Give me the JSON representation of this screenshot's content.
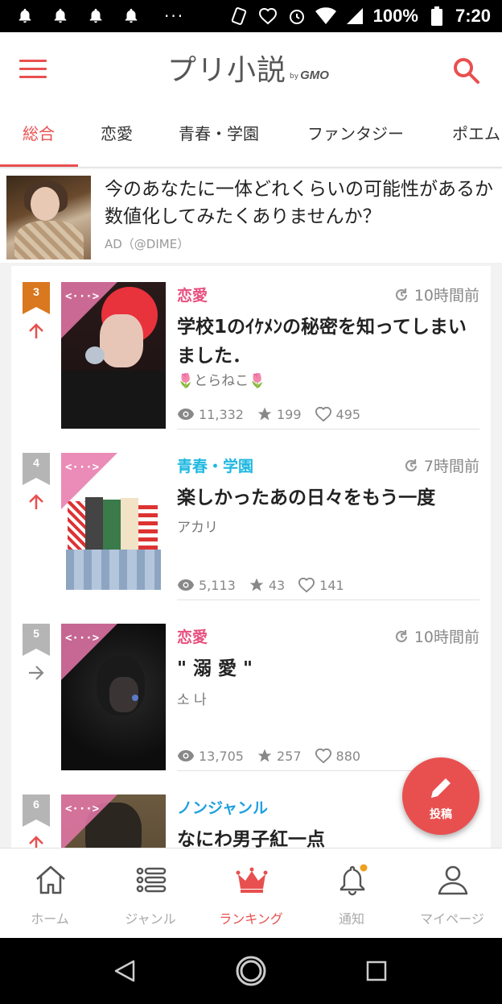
{
  "status_bar": {
    "battery": "100%",
    "time": "7:20",
    "overflow": "···"
  },
  "header": {
    "logo_main": "プリ小説",
    "logo_by": "by",
    "logo_gmo": "GMO",
    "menu_icon": "hamburger-icon",
    "search_icon": "search-icon"
  },
  "tabs": [
    {
      "label": "総合",
      "active": true
    },
    {
      "label": "恋愛",
      "active": false
    },
    {
      "label": "青春・学園",
      "active": false
    },
    {
      "label": "ファンタジー",
      "active": false
    },
    {
      "label": "ポエム",
      "active": false
    }
  ],
  "ad": {
    "title": "今のあなたに一体どれくらいの可能性があるか数値化してみたくありませんか？",
    "label": "AD（@DIME）"
  },
  "items": [
    {
      "rank": "3",
      "rank_color": "#d9781f",
      "trend": "up",
      "genre": "恋愛",
      "genre_color": "#e8507f",
      "time": "10時間前",
      "title": "学校1のｲｹﾒﾝの秘密を知ってしまいました．",
      "author": "🌷とらねこ🌷",
      "views": "11,332",
      "stars": "199",
      "likes": "495",
      "ribbon": "<···>"
    },
    {
      "rank": "4",
      "rank_color": "#b5b5b5",
      "trend": "up",
      "genre": "青春・学園",
      "genre_color": "#1fb8e0",
      "time": "7時間前",
      "title": "楽しかったあの日々をもう一度",
      "author": "アカリ",
      "views": "5,113",
      "stars": "43",
      "likes": "141",
      "ribbon": "<···>"
    },
    {
      "rank": "5",
      "rank_color": "#b5b5b5",
      "trend": "flat",
      "genre": "恋愛",
      "genre_color": "#e8507f",
      "time": "10時間前",
      "title": "\" 溺 愛 \"",
      "author": "소 나",
      "views": "13,705",
      "stars": "257",
      "likes": "880",
      "ribbon": "<···>"
    },
    {
      "rank": "6",
      "rank_color": "#b5b5b5",
      "trend": "up",
      "genre": "ノンジャンル",
      "genre_color": "#1fa0e0",
      "time": "",
      "title": "なにわ男子紅一点",
      "author": "",
      "views": "",
      "stars": "",
      "likes": "",
      "ribbon": "<···>"
    }
  ],
  "fab": {
    "label": "投稿",
    "icon": "pencil-icon"
  },
  "bottom_nav": [
    {
      "label": "ホーム",
      "icon": "home-icon",
      "active": false
    },
    {
      "label": "ジャンル",
      "icon": "list-icon",
      "active": false
    },
    {
      "label": "ランキング",
      "icon": "crown-icon",
      "active": true
    },
    {
      "label": "通知",
      "icon": "bell-icon",
      "active": false,
      "badge": true
    },
    {
      "label": "マイページ",
      "icon": "person-icon",
      "active": false
    }
  ],
  "colors": {
    "accent": "#e8504f",
    "rank_gold": "#d9781f",
    "rank_gray": "#b5b5b5"
  }
}
